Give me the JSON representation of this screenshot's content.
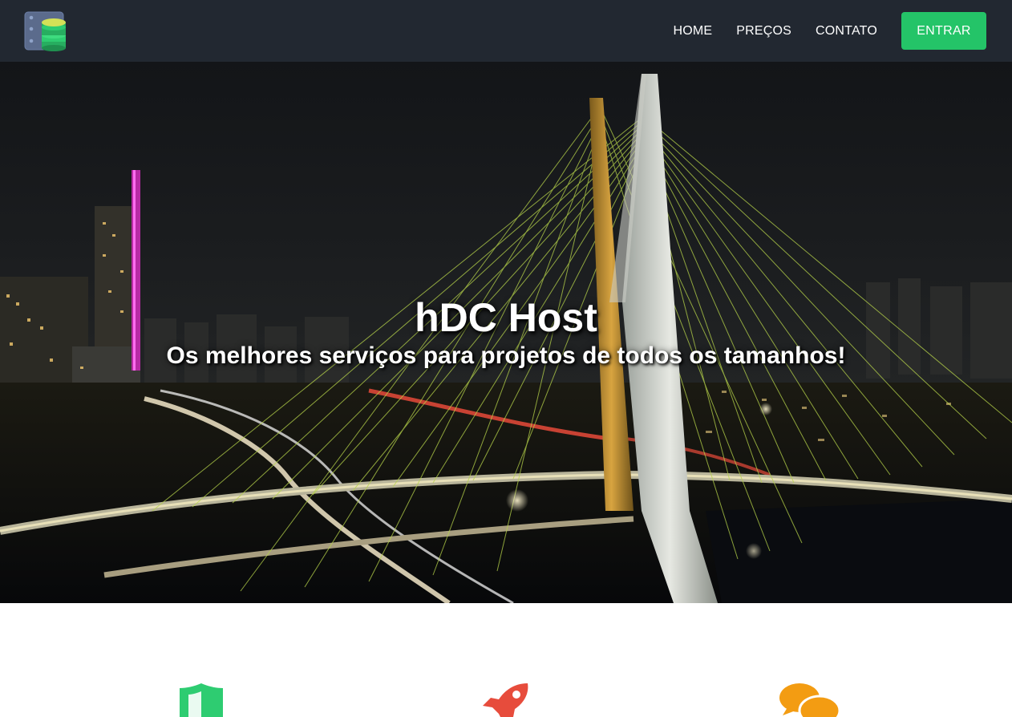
{
  "header": {
    "logo_icon": "server-database-icon",
    "nav": [
      {
        "label": "HOME"
      },
      {
        "label": "PREÇOS"
      },
      {
        "label": "CONTATO"
      }
    ],
    "login_label": "ENTRAR"
  },
  "hero": {
    "title": "hDC Host",
    "subtitle": "Os melhores serviços para projetos de todos os tamanhos!"
  },
  "features": [
    {
      "icon": "shield-icon",
      "color": "#2ecc71"
    },
    {
      "icon": "rocket-icon",
      "color": "#e74c3c"
    },
    {
      "icon": "chat-bubbles-icon",
      "color": "#f39c12"
    }
  ],
  "colors": {
    "header_bg": "#222831",
    "accent": "#24c468"
  }
}
